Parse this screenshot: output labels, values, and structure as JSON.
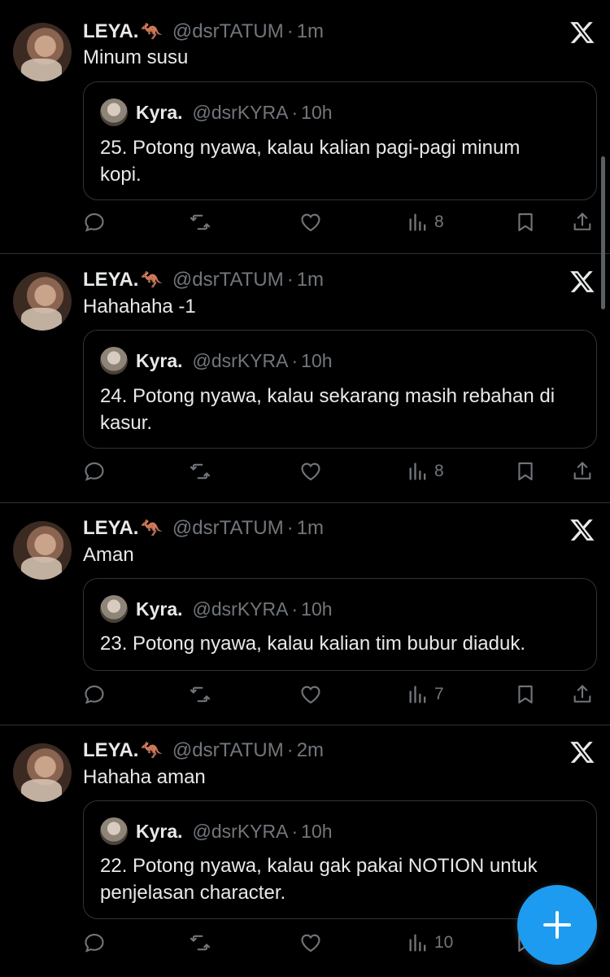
{
  "tweets": [
    {
      "author": {
        "name": "LEYA.",
        "emoji": "🦘",
        "handle": "@dsrTATUM",
        "time": "1m"
      },
      "text": "Minum susu",
      "quote": {
        "name": "Kyra.",
        "handle": "@dsrKYRA",
        "time": "10h",
        "lines": [
          "25. Potong nyawa, kalau kalian pagi-pagi minum",
          "kopi."
        ]
      },
      "views": "8"
    },
    {
      "author": {
        "name": "LEYA.",
        "emoji": "🦘",
        "handle": "@dsrTATUM",
        "time": "1m"
      },
      "text": "Hahahaha -1",
      "quote": {
        "name": "Kyra.",
        "handle": "@dsrKYRA",
        "time": "10h",
        "lines": [
          "24. Potong nyawa, kalau sekarang masih rebahan di",
          "kasur."
        ]
      },
      "views": "8"
    },
    {
      "author": {
        "name": "LEYA.",
        "emoji": "🦘",
        "handle": "@dsrTATUM",
        "time": "1m"
      },
      "text": "Aman",
      "quote": {
        "name": "Kyra.",
        "handle": "@dsrKYRA",
        "time": "10h",
        "lines": [
          "23. Potong nyawa, kalau kalian tim bubur diaduk."
        ]
      },
      "views": "7"
    },
    {
      "author": {
        "name": "LEYA.",
        "emoji": "🦘",
        "handle": "@dsrTATUM",
        "time": "2m"
      },
      "text": "Hahaha aman",
      "quote": {
        "name": "Kyra.",
        "handle": "@dsrKYRA",
        "time": "10h",
        "lines": [
          "22. Potong nyawa, kalau gak pakai NOTION untuk",
          "penjelasan character."
        ]
      },
      "views": "10"
    }
  ],
  "separator": "·",
  "icons": {
    "reply": "reply-icon",
    "retweet": "retweet-icon",
    "like": "like-icon",
    "views": "views-icon",
    "bookmark": "bookmark-icon",
    "share": "share-icon",
    "logo": "x-logo-icon",
    "compose": "plus-icon"
  },
  "colors": {
    "accent": "#1d9bf0",
    "muted": "#71767b",
    "text": "#e7e9ea",
    "border": "#2f3336"
  }
}
